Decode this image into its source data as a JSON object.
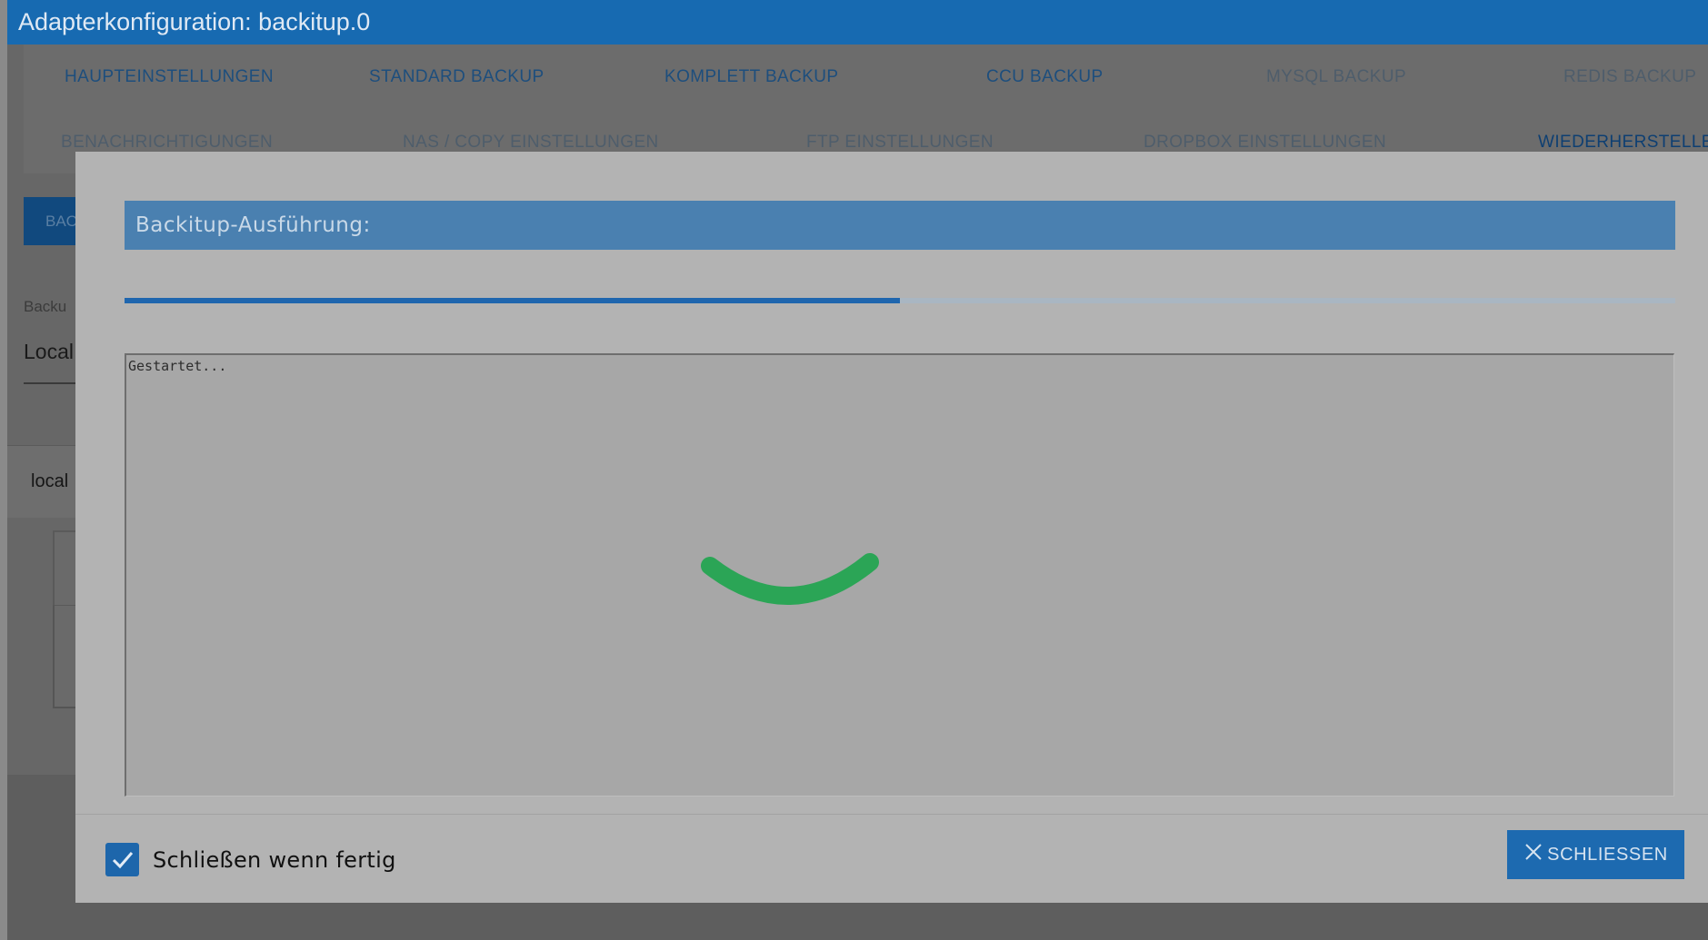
{
  "window": {
    "title": "Adapterkonfiguration: backitup.0"
  },
  "tabs": [
    {
      "label": "HAUPTEINSTELLUNGEN",
      "state": "enabled"
    },
    {
      "label": "STANDARD BACKUP",
      "state": "enabled"
    },
    {
      "label": "KOMPLETT BACKUP",
      "state": "enabled"
    },
    {
      "label": "CCU BACKUP",
      "state": "enabled"
    },
    {
      "label": "MYSQL BACKUP",
      "state": "disabled"
    },
    {
      "label": "REDIS BACKUP",
      "state": "disabled"
    },
    {
      "label": "BENACHRICHTIGUNGEN",
      "state": "disabled"
    },
    {
      "label": "NAS / COPY EINSTELLUNGEN",
      "state": "disabled"
    },
    {
      "label": "FTP EINSTELLUNGEN",
      "state": "disabled"
    },
    {
      "label": "DROPBOX EINSTELLUNGEN",
      "state": "disabled"
    },
    {
      "label": "WIEDERHERSTELLE",
      "state": "active"
    }
  ],
  "background": {
    "button_label": "BAC",
    "field_label": "Backu",
    "field_value": "Local",
    "list_item": "local"
  },
  "dialog": {
    "title": "Backitup-Ausführung:",
    "progress": 0.5,
    "log_text": "Gestartet...",
    "close_when_done_label": "Schließen wenn fertig",
    "close_when_done_checked": true,
    "close_button_label": "SCHLIESSEN"
  },
  "colors": {
    "title_bar": "#176ab1",
    "accent": "#1d6ab0",
    "spinner": "#2ba556",
    "progress_fill": "#1f66ae"
  },
  "icons": {
    "checkbox": "check-icon",
    "close": "close-icon",
    "loading": "loading-spinner-icon"
  }
}
